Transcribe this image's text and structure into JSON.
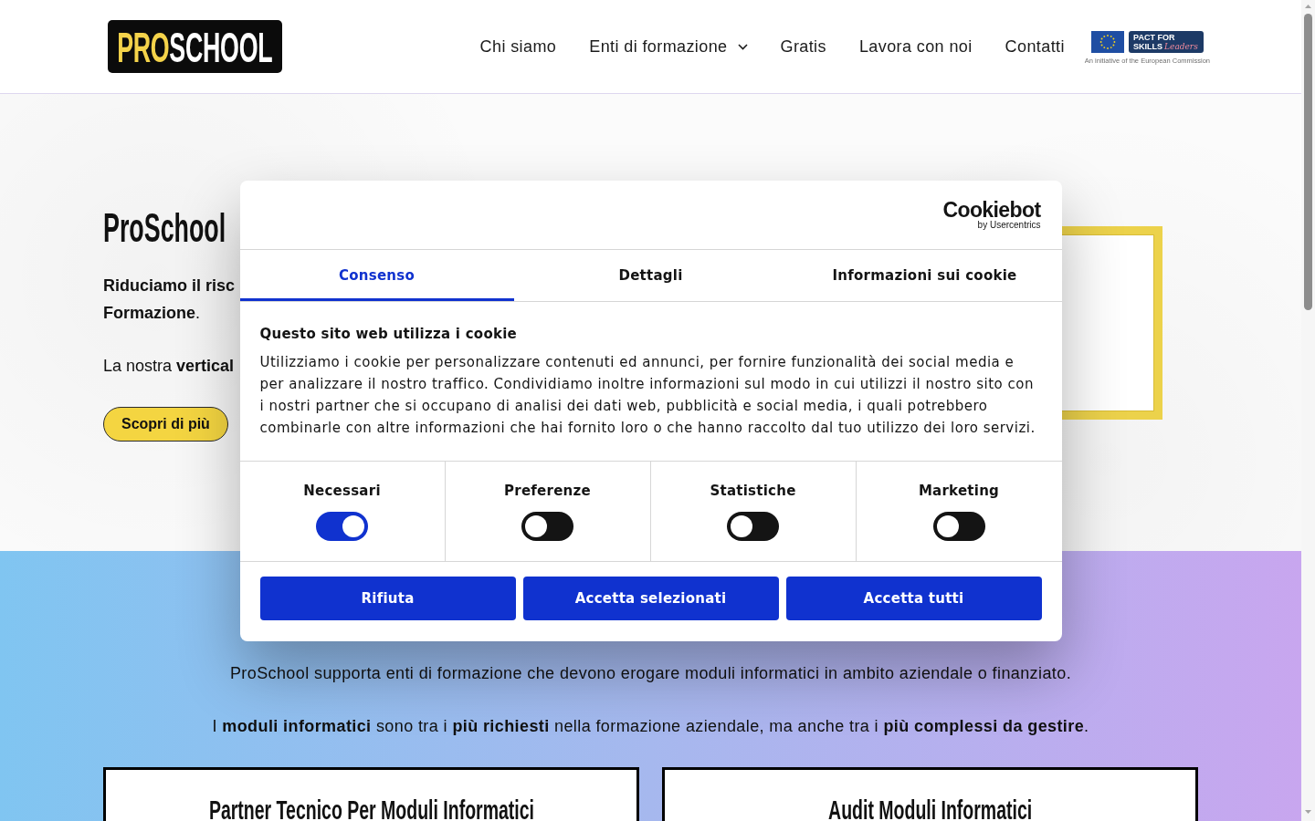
{
  "header": {
    "logo": {
      "highlight": "PRO",
      "rest": "SCHOOL"
    },
    "nav": [
      {
        "label": "Chi siamo",
        "dropdown": false
      },
      {
        "label": "Enti di formazione",
        "dropdown": true
      },
      {
        "label": "Gratis",
        "dropdown": false
      },
      {
        "label": "Lavora con noi",
        "dropdown": false
      },
      {
        "label": "Contatti",
        "dropdown": false
      }
    ],
    "badge": {
      "line_1": "PACT FOR",
      "line_2": "SKILLS",
      "script": "Leaders",
      "caption": "An initiative of the European Commission"
    }
  },
  "hero": {
    "title": "ProSchool",
    "intro_lines": [
      "**Riduciamo il risc**",
      "**Formazione**."
    ],
    "text": "La nostra **vertical**",
    "button": "Scopri di più"
  },
  "section": {
    "paragraphs": [
      "ProSchool supporta enti di formazione che devono erogare moduli informatici in ambito aziendale o finanziato.",
      "I **moduli informatici** sono tra i **più richiesti** nella formazione aziendale, ma anche tra i **più complessi da gestire**."
    ],
    "cards": [
      {
        "title": "Partner Tecnico Per Moduli Informatici"
      },
      {
        "title": "Audit Moduli Informatici"
      }
    ]
  },
  "cookie_dialog": {
    "brand": "Cookiebot",
    "brand_sub": "by Usercentrics",
    "tabs": [
      {
        "label": "Consenso",
        "selected": true
      },
      {
        "label": "Dettagli",
        "selected": false
      },
      {
        "label": "Informazioni sui cookie",
        "selected": false
      }
    ],
    "heading": "Questo sito web utilizza i cookie",
    "body": "Utilizziamo i cookie per personalizzare contenuti ed annunci, per fornire funzionalità dei social media e per analizzare il nostro traffico. Condividiamo inoltre informazioni sul modo in cui utilizzi il nostro sito con i nostri partner che si occupano di analisi dei dati web, pubblicità e social media, i quali potrebbero combinarle con altre informazioni che hai fornito loro o che hanno raccolto dal tuo utilizzo dei loro servizi.",
    "toggles": [
      {
        "label": "Necessari",
        "on": true
      },
      {
        "label": "Preferenze",
        "on": false
      },
      {
        "label": "Statistiche",
        "on": false
      },
      {
        "label": "Marketing",
        "on": false
      }
    ],
    "buttons": [
      "Rifiuta",
      "Accetta selezionati",
      "Accetta tutti"
    ]
  }
}
